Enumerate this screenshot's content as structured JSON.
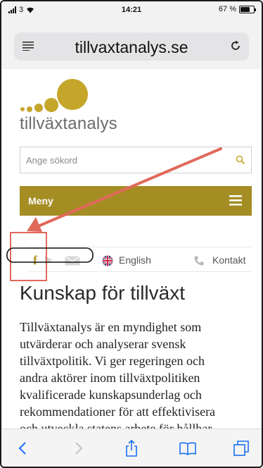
{
  "status_bar": {
    "carrier": "3",
    "time": "14:21",
    "battery_text": "67 %",
    "battery_level": 0.67
  },
  "browser": {
    "url": "tillvaxtanalys.se",
    "icons": [
      "reader-menu-icon",
      "reload-icon"
    ]
  },
  "site": {
    "logo_text": "tillväxtanalys",
    "logo_color": "#c5a62a",
    "search": {
      "placeholder": "Ange sökord"
    },
    "menu": {
      "label": "Meny",
      "color": "#a48d23"
    },
    "links": {
      "english": "English",
      "kontakt": "Kontakt"
    },
    "social_icons": [
      "facebook-icon",
      "youtube-icon",
      "mail-icon"
    ],
    "headline": "Kunskap för tillväxt",
    "body_lines": [
      "Tillväxtanalys är en myndighet som",
      "utvärderar och analyserar svensk",
      "tillväxtpolitik. Vi ger regeringen och",
      "andra aktörer inom tillväxtpolitiken",
      "kvalificerade kunskapsunderlag och",
      "rekommendationer för att effektivisera",
      "och utveckla statens arbete för hållbar"
    ]
  },
  "toolbar": {
    "items": [
      "back-icon",
      "forward-icon",
      "share-icon",
      "bookmarks-icon",
      "tabs-icon"
    ]
  },
  "annotation_colors": {
    "arrow": "#e0695a",
    "box": "#e0695a",
    "oval": "#111111"
  }
}
